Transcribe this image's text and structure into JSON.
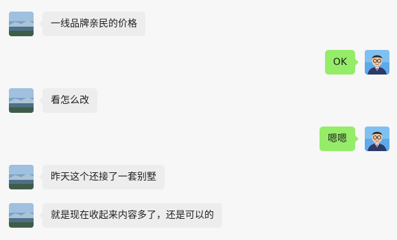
{
  "colors": {
    "background": "#f7f7f7",
    "incoming_bubble": "#ededed",
    "outgoing_bubble": "#95ec69",
    "text": "#1d1d1d"
  },
  "messages": [
    {
      "sender": "other",
      "avatar_icon": "landscape-avatar-icon",
      "text": "一线品牌亲民的价格"
    },
    {
      "sender": "self",
      "avatar_icon": "man-with-glasses-avatar-icon",
      "text": "OK"
    },
    {
      "sender": "other",
      "avatar_icon": "landscape-avatar-icon",
      "text": "看怎么改"
    },
    {
      "sender": "self",
      "avatar_icon": "man-with-glasses-avatar-icon",
      "text": "嗯嗯"
    },
    {
      "sender": "other",
      "avatar_icon": "landscape-avatar-icon",
      "text": "昨天这个还接了一套别墅"
    },
    {
      "sender": "other",
      "avatar_icon": "landscape-avatar-icon",
      "text": "就是现在收起来内容多了，还是可以的"
    }
  ]
}
